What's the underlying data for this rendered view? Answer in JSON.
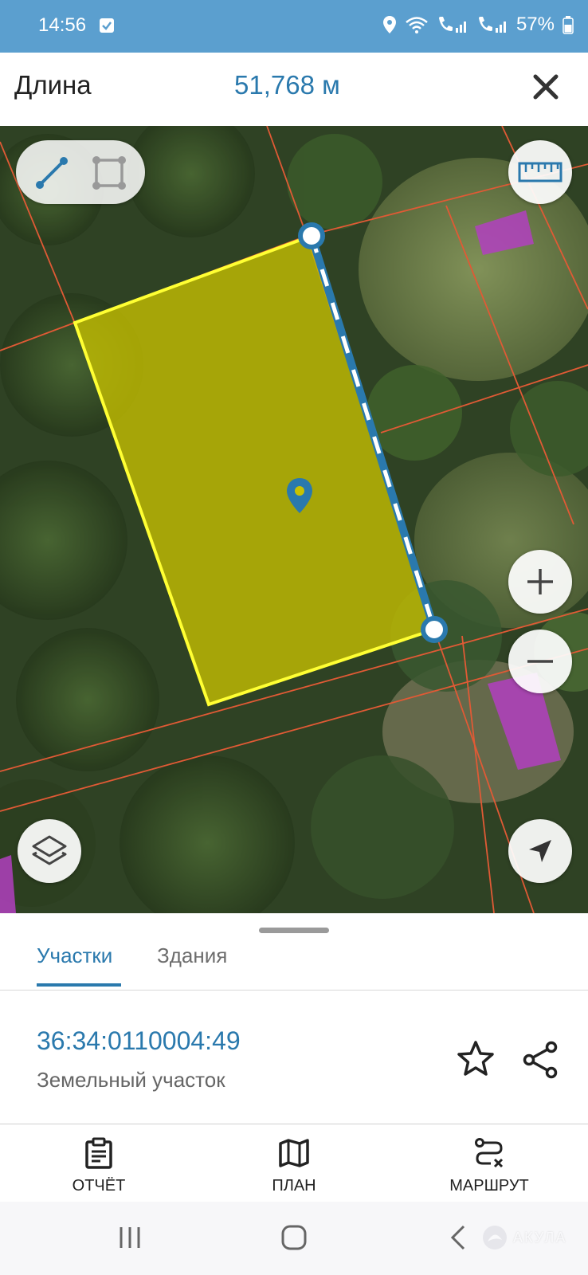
{
  "status_bar": {
    "time": "14:56",
    "battery": "57%"
  },
  "measure": {
    "label": "Длина",
    "value": "51,768 м"
  },
  "tabs": [
    {
      "label": "Участки",
      "active": true
    },
    {
      "label": "Здания",
      "active": false
    }
  ],
  "parcel": {
    "cadastral_number": "36:34:0110004:49",
    "type": "Земельный участок"
  },
  "bottom_nav": [
    {
      "label": "ОТЧЁТ",
      "icon": "clipboard-icon"
    },
    {
      "label": "ПЛАН",
      "icon": "map-icon"
    },
    {
      "label": "МАРШРУТ",
      "icon": "route-icon"
    }
  ],
  "watermark": "АКУЛА",
  "colors": {
    "accent": "#2a79ad",
    "status_bar": "#5b9fcf",
    "parcel_fill": "#c8c200",
    "parcel_border": "#ffff33",
    "building": "#b23fc0",
    "boundary": "#e05a35"
  }
}
